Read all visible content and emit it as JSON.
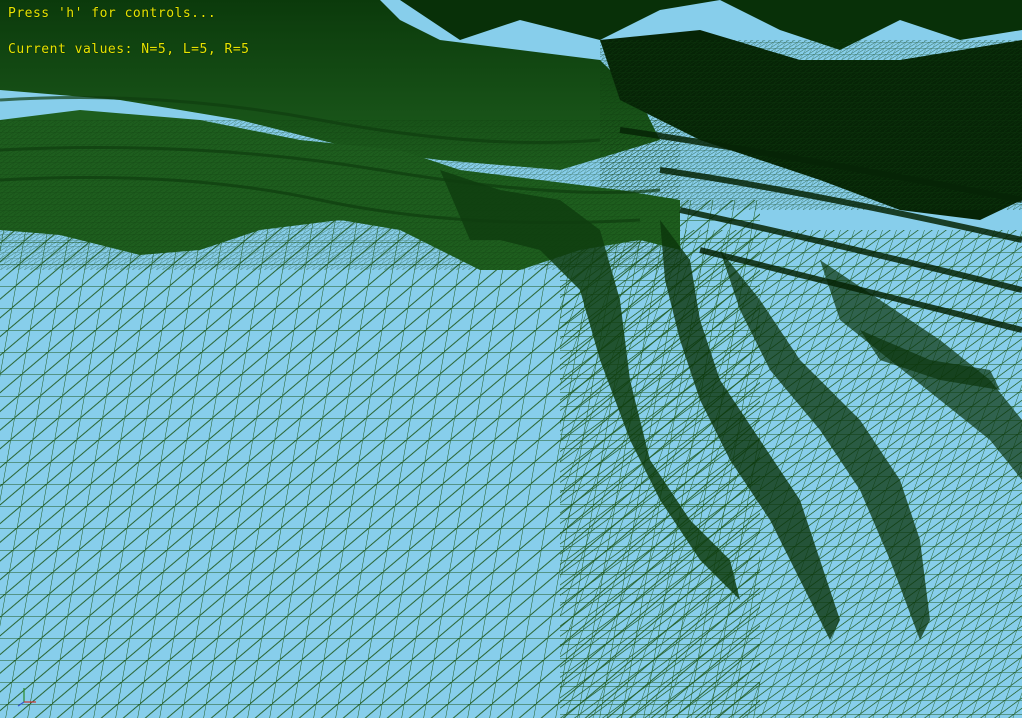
{
  "hud": {
    "hint": "Press 'h' for controls...",
    "values": "Current values: N=5, L=5, R=5"
  },
  "scene": {
    "sky_color": "#87ceeb",
    "mesh_color": "#1f5a1f",
    "ridge_color": "#0f3d0f",
    "shadow_color": "#062406",
    "hud_color": "#e6e600"
  },
  "icons": {
    "axis": "axis-gizmo-icon"
  }
}
